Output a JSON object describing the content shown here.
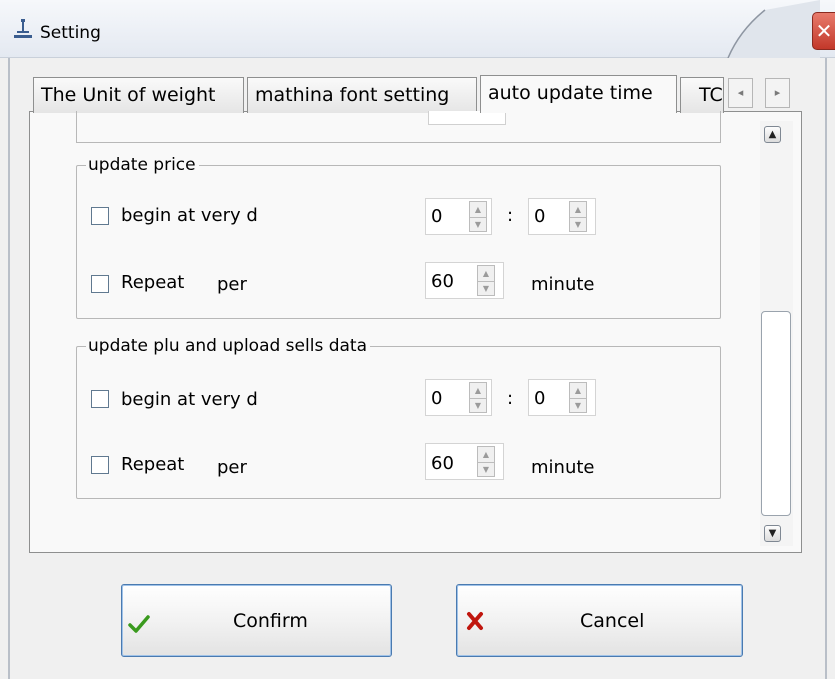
{
  "window": {
    "title": "Setting",
    "close_glyph": "✕"
  },
  "tabs": [
    {
      "label": "The Unit of weight",
      "active": false
    },
    {
      "label": "mathina font setting",
      "active": false
    },
    {
      "label": "auto update time",
      "active": true
    },
    {
      "label": "TC",
      "active": false
    }
  ],
  "tab_scroll": {
    "left_glyph": "◂",
    "right_glyph": "▸"
  },
  "scrollbar": {
    "up_glyph": "▲",
    "down_glyph": "▼"
  },
  "groups": {
    "update_price": {
      "title": "update price",
      "begin": {
        "label": "begin at very d",
        "checked": false,
        "hour": "0",
        "separator": ":",
        "minute": "0"
      },
      "repeat": {
        "label": "Repeat",
        "per_label": "per",
        "value": "60",
        "unit": "minute",
        "checked": false
      }
    },
    "update_plu": {
      "title": "update plu and upload sells data",
      "begin": {
        "label": "begin at very d",
        "checked": false,
        "hour": "0",
        "separator": ":",
        "minute": "0"
      },
      "repeat": {
        "label": "Repeat",
        "per_label": "per",
        "value": "60",
        "unit": "minute",
        "checked": false
      }
    }
  },
  "buttons": {
    "confirm_label": "Confirm",
    "cancel_label": "Cancel"
  },
  "icons": {
    "title": "scale-icon",
    "confirm": "check-icon",
    "cancel": "x-icon"
  },
  "colors": {
    "check_green": "#3a9a1e",
    "cancel_red": "#c0160e",
    "close_red": "#c2382a"
  }
}
